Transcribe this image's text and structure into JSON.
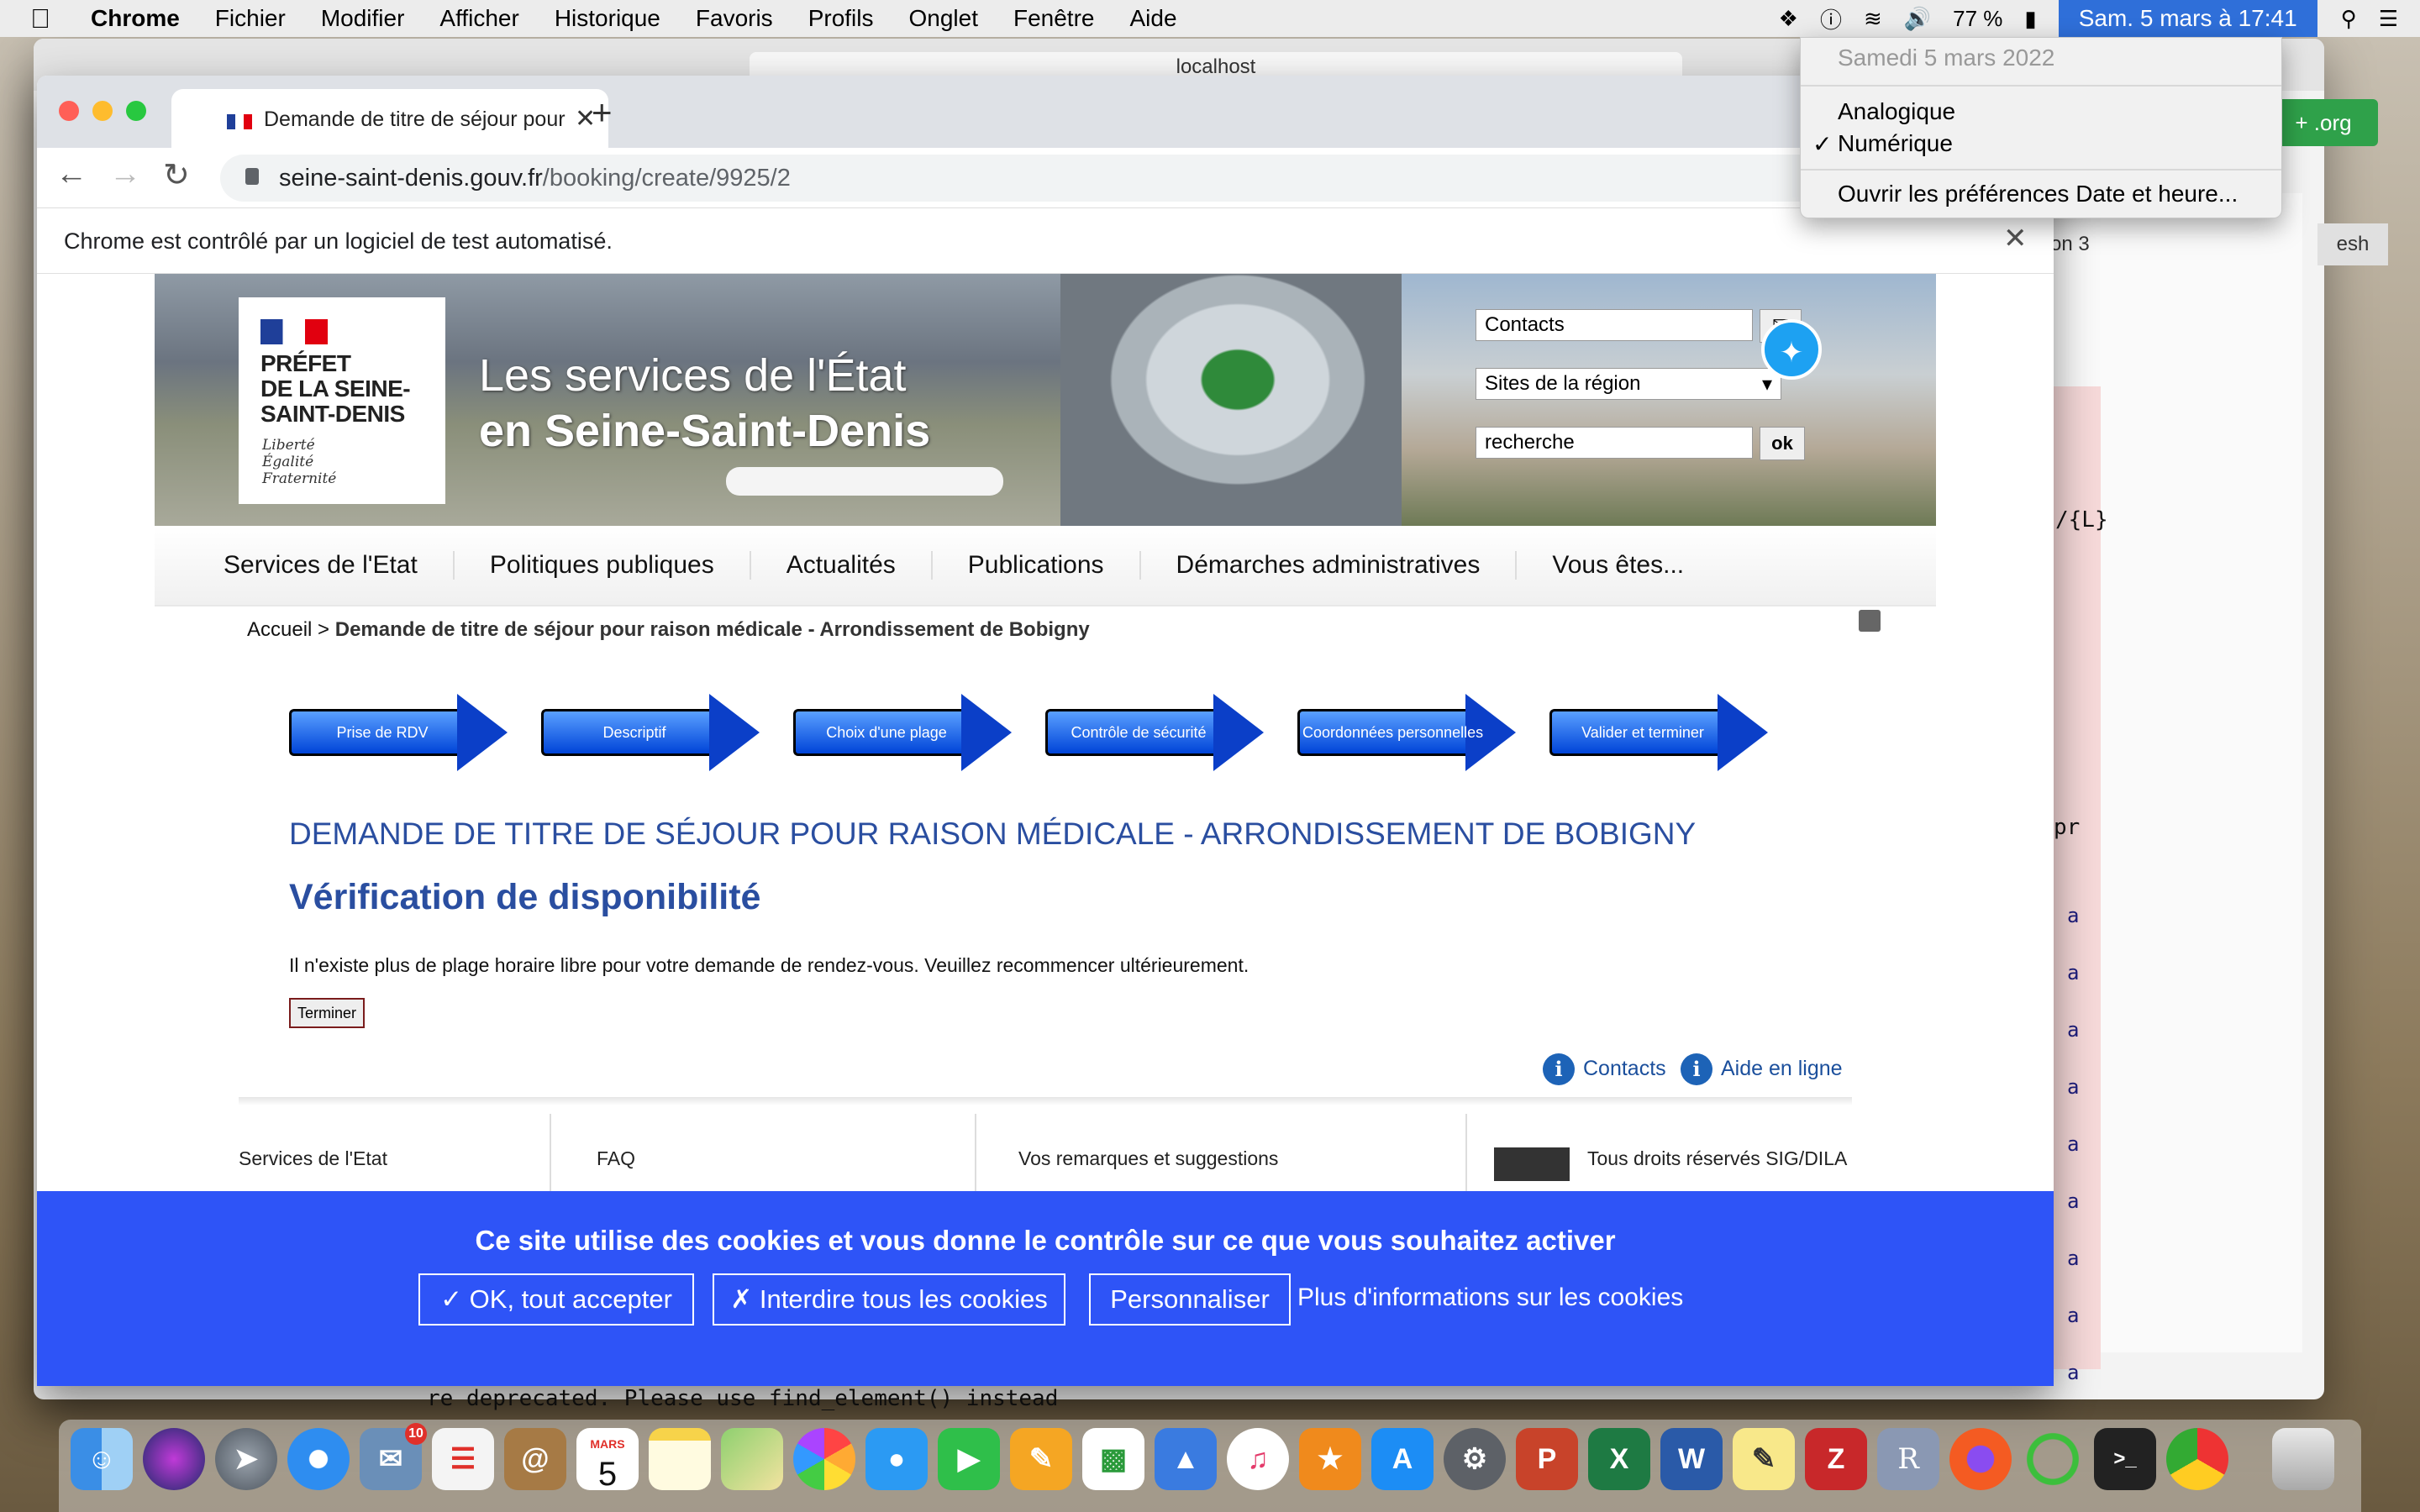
{
  "menubar": {
    "app": "Chrome",
    "items": [
      "Fichier",
      "Modifier",
      "Afficher",
      "Historique",
      "Favoris",
      "Profils",
      "Onglet",
      "Fenêtre",
      "Aide"
    ],
    "battery": "77 %",
    "clock": "Sam. 5 mars à  17:41",
    "status_icons": [
      "dropbox-icon",
      "clock-alert-icon",
      "wifi-icon",
      "volume-icon",
      "battery-icon",
      "spotlight-icon",
      "notification-center-icon"
    ]
  },
  "date_menu": {
    "date": "Samedi 5 mars 2022",
    "option_analog": "Analogique",
    "option_digital": "Numérique",
    "checkmark": "✓",
    "prefs": "Ouvrir les préférences Date et heure..."
  },
  "back_window": {
    "address": "localhost",
    "green_button": "+ .org",
    "tab_label": "on 3",
    "refresh_button": "esh",
    "code_fragment": "/{L}",
    "code_pr": "pr",
    "code_letter": "a",
    "deprecation": "re deprecated. Please use find_element() instead"
  },
  "browser": {
    "tab_title": "Demande de titre de séjour pour",
    "url_host": "seine-saint-denis.gouv.fr",
    "url_path": "/booking/create/9925/2",
    "infobar": "Chrome est contrôlé par un logiciel de test automatisé."
  },
  "site": {
    "logo_text": "PRÉFET\nDE LA SEINE-\nSAINT-DENIS",
    "logo_motto": "Liberté\nÉgalité\nFraternité",
    "banner_title_1": "Les services de l'État",
    "banner_title_2": "en Seine-Saint-Denis",
    "contacts_field": "Contacts",
    "sites_select": "Sites de la région",
    "search_field": "recherche",
    "ok": "ok",
    "nav": [
      "Services de l'Etat",
      "Politiques publiques",
      "Actualités",
      "Publications",
      "Démarches administratives",
      "Vous êtes..."
    ],
    "breadcrumb_home": "Accueil",
    "breadcrumb_sep": " > ",
    "breadcrumb_current": "Demande de titre de séjour pour raison médicale - Arrondissement de Bobigny",
    "steps": [
      "Prise de RDV",
      "Descriptif",
      "Choix d'une plage",
      "Contrôle de sécurité",
      "Coordonnées personnelles",
      "Valider et terminer"
    ],
    "heading": "DEMANDE DE TITRE DE SÉJOUR POUR RAISON MÉDICALE - ARRONDISSEMENT DE BOBIGNY",
    "subheading": "Vérification de disponibilité",
    "message": "Il n'existe plus de plage horaire libre pour votre demande de rendez-vous. Veuillez recommencer ultérieurement.",
    "finish_button": "Terminer",
    "contacts_link": "Contacts",
    "help_link": "Aide en ligne",
    "footer": [
      "Services de l'Etat",
      "FAQ",
      "Vos remarques et suggestions",
      "Tous droits réservés SIG/DILA"
    ]
  },
  "cookie": {
    "title": "Ce site utilise des cookies et vous donne le contrôle sur ce que vous souhaitez activer",
    "accept": "✓ OK, tout accepter",
    "deny": "✗ Interdire tous les cookies",
    "customize": "Personnaliser",
    "more": "Plus d'informations sur les cookies"
  },
  "dock": {
    "calendar_month": "MARS",
    "calendar_day": "5",
    "mail_badge": "10",
    "r_label": "R",
    "terminal_label": ">_"
  }
}
